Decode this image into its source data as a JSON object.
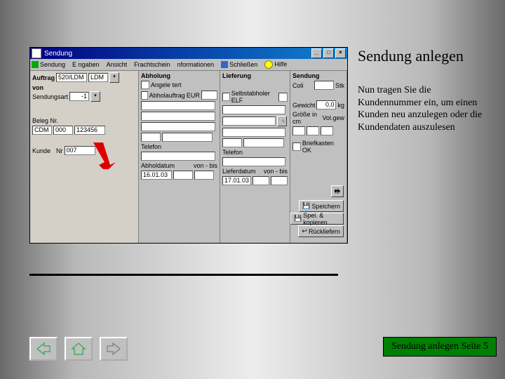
{
  "slide": {
    "title": "Sendung anlegen",
    "description": "Nun tragen Sie die Kundennummer ein, um einen Kunden neu anzulegen oder die Kundendaten auszulesen",
    "footer": "Sendung anlegen Seite 5"
  },
  "window": {
    "title": "Sendung",
    "menu": [
      "Sendung",
      "E ngaben",
      "Ansicht",
      "Frachtschein",
      "nformationen",
      "Schließen",
      "Hilfe"
    ]
  },
  "col1": {
    "auftrag_lbl": "Auftrag",
    "auftrag_val": "520/LDM",
    "auftrag_type": "LDM",
    "von_lbl": "von",
    "sendungsart_lbl": "Sendungsart",
    "sendungsart_val": "-1",
    "beleg_lbl": "Beleg Nr.",
    "beleg_a": "CDM",
    "beleg_b": "000",
    "beleg_c": "123456",
    "kunde_lbl": "Kunde",
    "kunde_nr_lbl": "Nr",
    "kunde_nr_val": "007"
  },
  "col2": {
    "header": "Abholung",
    "angele_lbl": "Angele tert",
    "abhol_lbl": "Abholauftrag",
    "eur_lbl": "EUR",
    "telefon_lbl": "Telefon",
    "abholdatum_lbl": "Abholdatum",
    "abholdatum_val": "16.01.03",
    "vonbis_lbl": "von - bis"
  },
  "col3": {
    "header": "Lieferung",
    "selbst_lbl": "Selbstabholer ELF",
    "telefon_lbl": "Telefon",
    "lieferdatum_lbl": "Lieferdatum",
    "lieferdatum_val": "17.01.03",
    "vonbis_lbl": "von - bis"
  },
  "col4": {
    "header": "Sendung",
    "coli_lbl": "Coli",
    "stk_lbl": "Stk",
    "gewicht_lbl": "Gewicht",
    "gewicht_val": "0,0",
    "kg_lbl": "kg",
    "groesse_lbl": "Größe in cm",
    "volgew_lbl": "Vol.gew",
    "brief_lbl": "Briefkasten OK",
    "btn_speichern": "Speichern",
    "btn_kopieren": "Spei. & kopieren",
    "btn_rueck": "Rückliefern"
  }
}
